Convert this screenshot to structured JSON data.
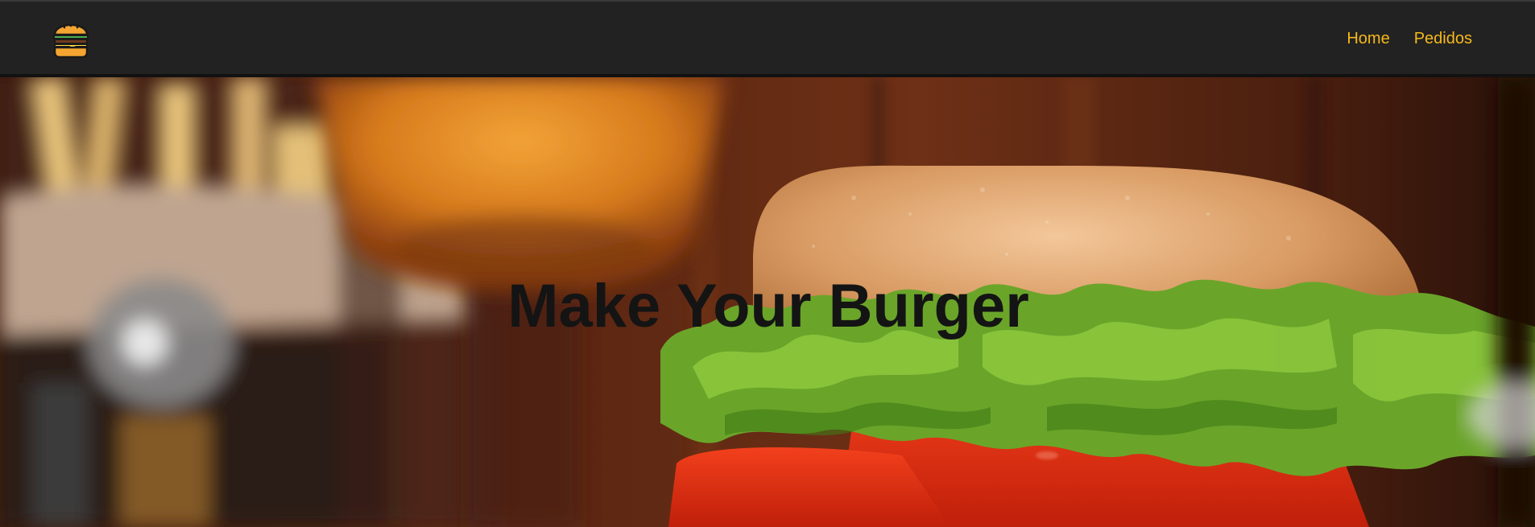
{
  "brand": {
    "logo_icon": "burger-icon",
    "accent_color": "#f6b81a",
    "navbar_color": "#222222"
  },
  "nav": {
    "items": [
      {
        "label": "Home"
      },
      {
        "label": "Pedidos"
      }
    ]
  },
  "hero": {
    "title": "Make Your Burger",
    "background_image": "burger-photo",
    "title_color": "#141414"
  }
}
